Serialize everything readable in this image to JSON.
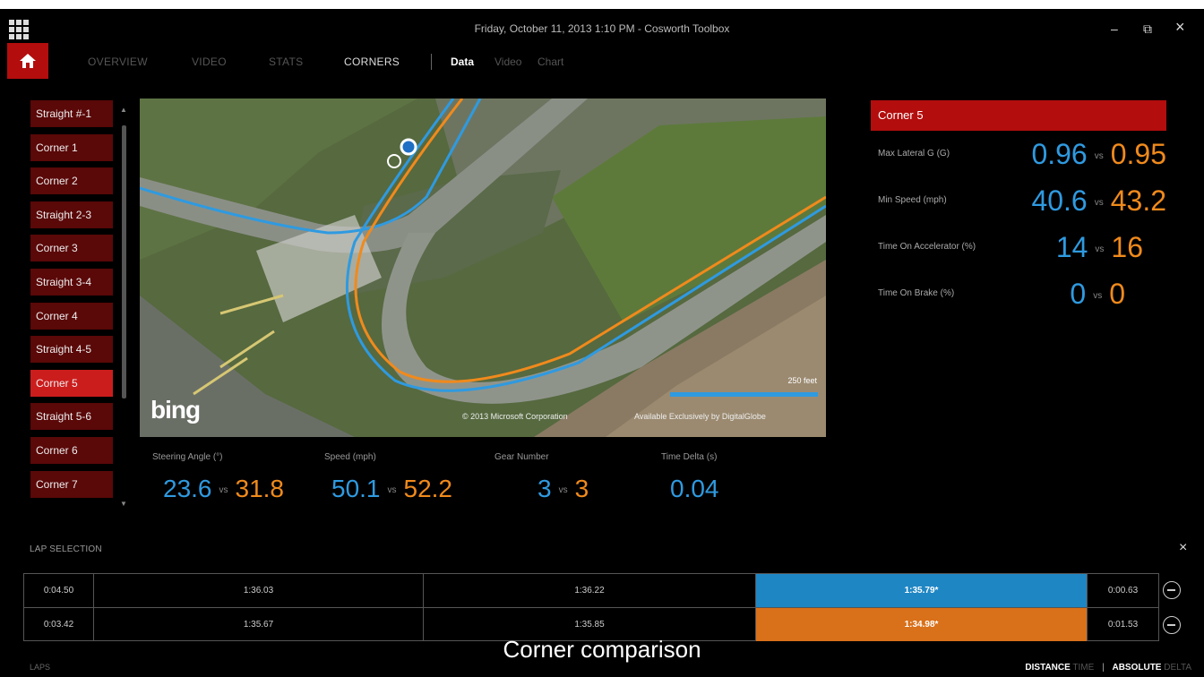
{
  "window": {
    "title": "Friday, October 11, 2013 1:10 PM - Cosworth Toolbox",
    "minimize_label": "–",
    "restore_label": "⧉",
    "close_label": "×"
  },
  "nav": {
    "tabs": [
      "OVERVIEW",
      "VIDEO",
      "STATS",
      "CORNERS"
    ],
    "active_tab": "CORNERS",
    "subtabs": [
      "Data",
      "Video",
      "Chart"
    ],
    "active_subtab": "Data"
  },
  "corner_list": {
    "items": [
      "Straight #-1",
      "Corner 1",
      "Corner 2",
      "Straight 2-3",
      "Corner 3",
      "Straight 3-4",
      "Corner 4",
      "Straight 4-5",
      "Corner 5",
      "Straight 5-6",
      "Corner 6",
      "Corner 7"
    ],
    "selected": "Corner 5"
  },
  "map": {
    "brand": "bing",
    "scale_label": "250 feet",
    "copyright": "© 2013 Microsoft Corporation",
    "imagery_credit": "Available Exclusively by DigitalGlobe",
    "line_colors": {
      "blue": "#2f9ae0",
      "orange": "#f08a1c"
    }
  },
  "metrics": [
    {
      "label": "Steering Angle (°)",
      "blue": "23.6",
      "orange": "31.8"
    },
    {
      "label": "Speed (mph)",
      "blue": "50.1",
      "orange": "52.2"
    },
    {
      "label": "Gear Number",
      "blue": "3",
      "orange": "3"
    },
    {
      "label": "Time Delta (s)",
      "blue": "0.04"
    }
  ],
  "vs_label": "vs",
  "corner_panel": {
    "title": "Corner 5",
    "rows": [
      {
        "label": "Max Lateral G (G)",
        "blue": "0.96",
        "orange": "0.95"
      },
      {
        "label": "Min Speed (mph)",
        "blue": "40.6",
        "orange": "43.2"
      },
      {
        "label": "Time On Accelerator (%)",
        "blue": "14",
        "orange": "16"
      },
      {
        "label": "Time On Brake (%)",
        "blue": "0",
        "orange": "0"
      }
    ]
  },
  "lap_selection": {
    "title": "LAP SELECTION",
    "close_label": "×",
    "rows": [
      {
        "delta_left": "0:04.50",
        "laps": [
          "1:36.03",
          "1:36.22",
          "1:35.79*"
        ],
        "highlight": "blue",
        "delta_right": "0:00.63"
      },
      {
        "delta_left": "0:03.42",
        "laps": [
          "1:35.67",
          "1:35.85",
          "1:34.98*"
        ],
        "highlight": "orange",
        "delta_right": "0:01.53"
      }
    ]
  },
  "caption": "Corner comparison",
  "bottom": {
    "laps_label": "LAPS",
    "distance": "DISTANCE",
    "time": "TIME",
    "separator": "|",
    "absolute": "ABSOLUTE",
    "delta": "DELTA"
  },
  "colors": {
    "accent_red": "#b30d0d",
    "selected_red": "#cc1d1d",
    "list_red": "#5a0808",
    "blue": "#2f9ae0",
    "orange": "#f08a1c"
  }
}
